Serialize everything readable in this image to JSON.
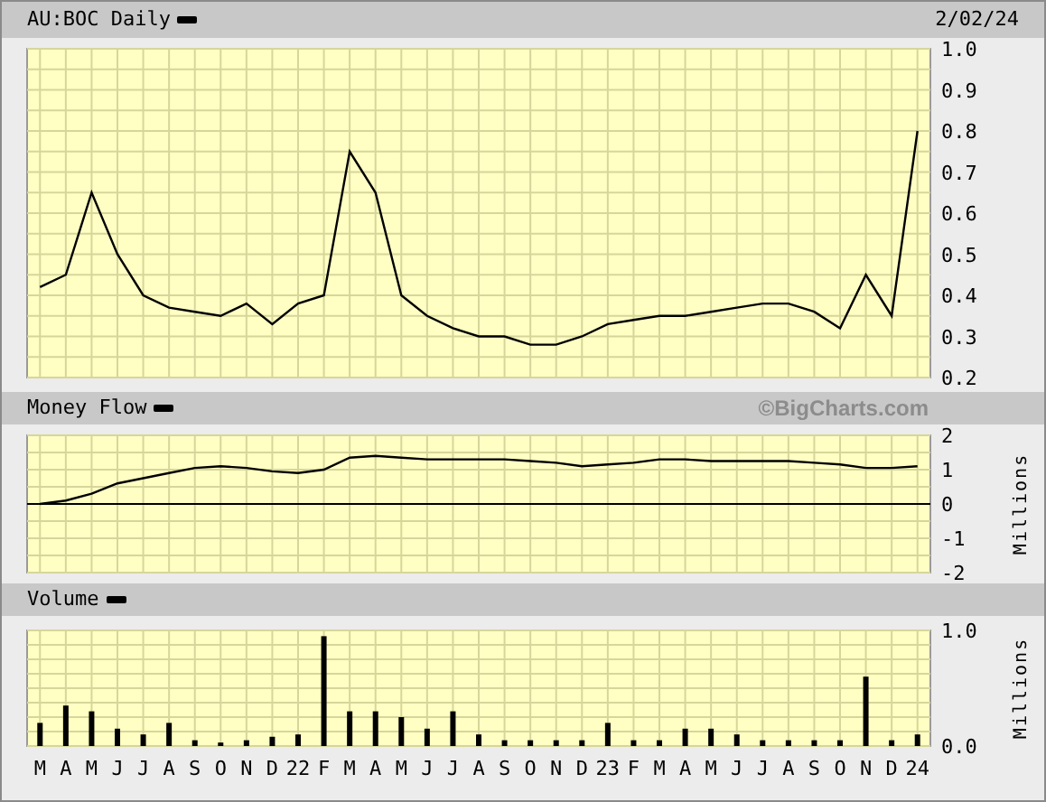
{
  "header": {
    "date": "2/02/24"
  },
  "price": {
    "chart_data": {
      "type": "line",
      "grid": true,
      "ylim": [
        0.2,
        1.0
      ],
      "yticks": [
        {
          "value": 0.2,
          "label": "0.2"
        },
        {
          "value": 0.3,
          "label": "0.3"
        },
        {
          "value": 0.4,
          "label": "0.4"
        },
        {
          "value": 0.5,
          "label": "0.5"
        },
        {
          "value": 0.6,
          "label": "0.6"
        },
        {
          "value": 0.7,
          "label": "0.7"
        },
        {
          "value": 0.8,
          "label": "0.8"
        },
        {
          "value": 0.9,
          "label": "0.9"
        },
        {
          "value": 1.0,
          "label": "1.0"
        }
      ],
      "series": [
        {
          "name": "AU:BOC Daily",
          "color": "#000000",
          "values": [
            0.42,
            0.45,
            0.65,
            0.5,
            0.4,
            0.37,
            0.36,
            0.35,
            0.38,
            0.33,
            0.38,
            0.4,
            0.75,
            0.65,
            0.4,
            0.35,
            0.32,
            0.3,
            0.3,
            0.28,
            0.28,
            0.3,
            0.33,
            0.34,
            0.35,
            0.35,
            0.36,
            0.37,
            0.38,
            0.38,
            0.36,
            0.32,
            0.45,
            0.35,
            0.8
          ]
        }
      ]
    }
  },
  "money_flow": {
    "credit": "©BigCharts.com",
    "chart_data": {
      "type": "line",
      "grid": true,
      "ylabel": "Millions",
      "ylim": [
        -2,
        2
      ],
      "yticks": [
        -2,
        -1,
        0,
        1,
        2
      ],
      "series": [
        {
          "name": "Money Flow",
          "color": "#000000",
          "values": [
            0.0,
            0.1,
            0.3,
            0.6,
            0.75,
            0.9,
            1.05,
            1.1,
            1.05,
            0.95,
            0.9,
            1.0,
            1.35,
            1.4,
            1.35,
            1.3,
            1.3,
            1.3,
            1.3,
            1.25,
            1.2,
            1.1,
            1.15,
            1.2,
            1.3,
            1.3,
            1.25,
            1.25,
            1.25,
            1.25,
            1.2,
            1.15,
            1.05,
            1.05,
            1.1
          ]
        }
      ]
    }
  },
  "volume": {
    "chart_data": {
      "type": "bar",
      "grid": true,
      "ylabel": "Millions",
      "categories": [
        "M",
        "A",
        "M",
        "J",
        "J",
        "A",
        "S",
        "O",
        "N",
        "D",
        "22",
        "F",
        "M",
        "A",
        "M",
        "J",
        "J",
        "A",
        "S",
        "O",
        "N",
        "D",
        "23",
        "F",
        "M",
        "A",
        "M",
        "J",
        "J",
        "A",
        "S",
        "O",
        "N",
        "D",
        "24"
      ],
      "ylim": [
        0,
        1
      ],
      "yticks": [
        {
          "value": 0,
          "label": "0.0"
        },
        {
          "value": 1,
          "label": "1.0"
        }
      ],
      "series": [
        {
          "name": "Volume",
          "color": "#000000",
          "values": [
            0.2,
            0.35,
            0.3,
            0.15,
            0.1,
            0.2,
            0.05,
            0.03,
            0.05,
            0.08,
            0.1,
            0.95,
            0.3,
            0.3,
            0.25,
            0.15,
            0.3,
            0.1,
            0.05,
            0.05,
            0.05,
            0.05,
            0.2,
            0.05,
            0.05,
            0.15,
            0.15,
            0.1,
            0.05,
            0.05,
            0.05,
            0.05,
            0.6,
            0.05,
            0.1
          ]
        }
      ]
    }
  }
}
